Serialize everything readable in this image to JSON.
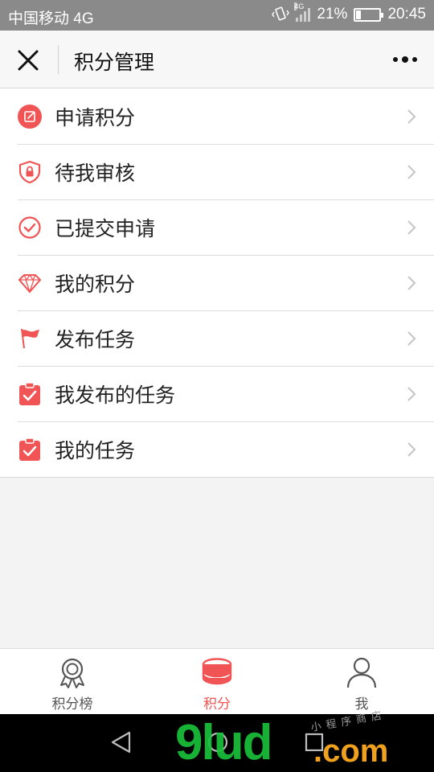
{
  "status_bar": {
    "carrier": "中国移动 4G",
    "network_badge": "4G",
    "battery": "21%",
    "battery_level": 0.21,
    "time": "20:45"
  },
  "header": {
    "title": "积分管理",
    "close_icon": "close-icon",
    "more_icon": "more-dots-icon"
  },
  "menu": [
    {
      "label": "申请积分",
      "icon": "edit-icon"
    },
    {
      "label": "待我审核",
      "icon": "shield-lock-icon"
    },
    {
      "label": "已提交申请",
      "icon": "check-circle-icon"
    },
    {
      "label": "我的积分",
      "icon": "diamond-icon"
    },
    {
      "label": "发布任务",
      "icon": "flag-icon"
    },
    {
      "label": "我发布的任务",
      "icon": "clipboard-check-icon"
    },
    {
      "label": "我的任务",
      "icon": "clipboard-check-icon"
    }
  ],
  "tabbar": [
    {
      "label": "积分榜",
      "icon": "award-icon",
      "active": false
    },
    {
      "label": "积分",
      "icon": "coins-icon",
      "active": true
    },
    {
      "label": "我",
      "icon": "user-icon",
      "active": false
    }
  ],
  "watermark": {
    "main": "9lud",
    "domain": ".com",
    "small": "小程序商店"
  },
  "colors": {
    "accent": "#f05454",
    "status_bar": "#8a8a8a",
    "background": "#f3f3f3"
  }
}
